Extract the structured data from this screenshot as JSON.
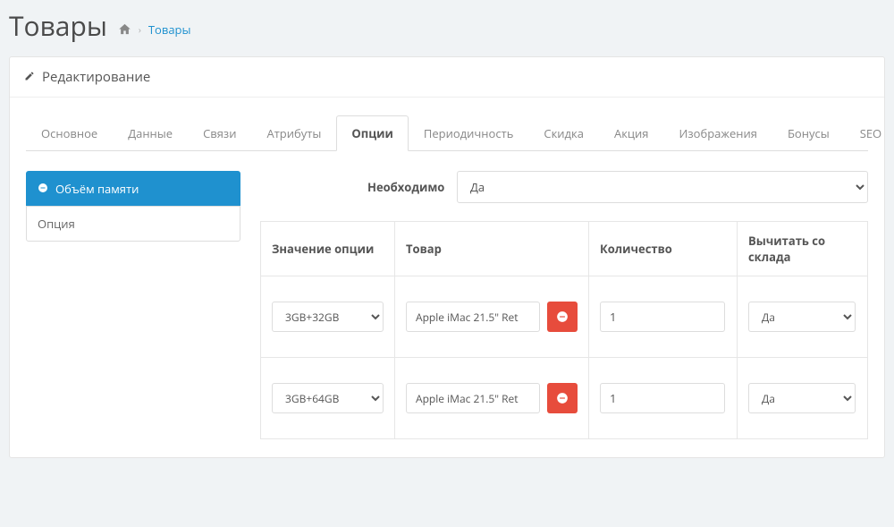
{
  "header": {
    "title": "Товары",
    "breadcrumb_link": "Товары"
  },
  "panel": {
    "heading": "Редактирование"
  },
  "tabs": [
    {
      "label": "Основное",
      "active": false
    },
    {
      "label": "Данные",
      "active": false
    },
    {
      "label": "Связи",
      "active": false
    },
    {
      "label": "Атрибуты",
      "active": false
    },
    {
      "label": "Опции",
      "active": true
    },
    {
      "label": "Периодичность",
      "active": false
    },
    {
      "label": "Скидка",
      "active": false
    },
    {
      "label": "Акция",
      "active": false
    },
    {
      "label": "Изображения",
      "active": false
    },
    {
      "label": "Бонусы",
      "active": false
    },
    {
      "label": "SEO",
      "active": false
    }
  ],
  "option_sidebar": {
    "active_label": "Объём памяти",
    "add_label": "Опция"
  },
  "required": {
    "label": "Необходимо",
    "value": "Да"
  },
  "table": {
    "headers": {
      "value": "Значение опции",
      "product": "Товар",
      "qty": "Количество",
      "stock": "Вычитать со склада"
    },
    "rows": [
      {
        "value": "3GB+32GB",
        "product": "Apple iMac 21.5\" Ret",
        "qty": "1",
        "stock": "Да"
      },
      {
        "value": "3GB+64GB",
        "product": "Apple iMac 21.5\" Ret",
        "qty": "1",
        "stock": "Да"
      }
    ]
  }
}
